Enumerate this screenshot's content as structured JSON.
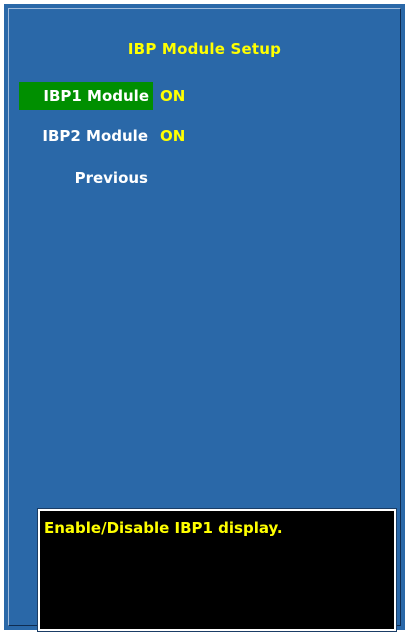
{
  "menu": {
    "title": "IBP Module Setup",
    "items": [
      {
        "label": "IBP1 Module",
        "value": "ON",
        "selected": true
      },
      {
        "label": "IBP2 Module",
        "value": "ON",
        "selected": false
      },
      {
        "label": "Previous",
        "value": "",
        "selected": false
      }
    ]
  },
  "help": {
    "text": "Enable/Disable IBP1 display."
  },
  "colors": {
    "background": "#2a68a8",
    "selection": "#008f00",
    "value_text": "#ffff00",
    "label_text": "#ffffff",
    "help_background": "#000000"
  }
}
